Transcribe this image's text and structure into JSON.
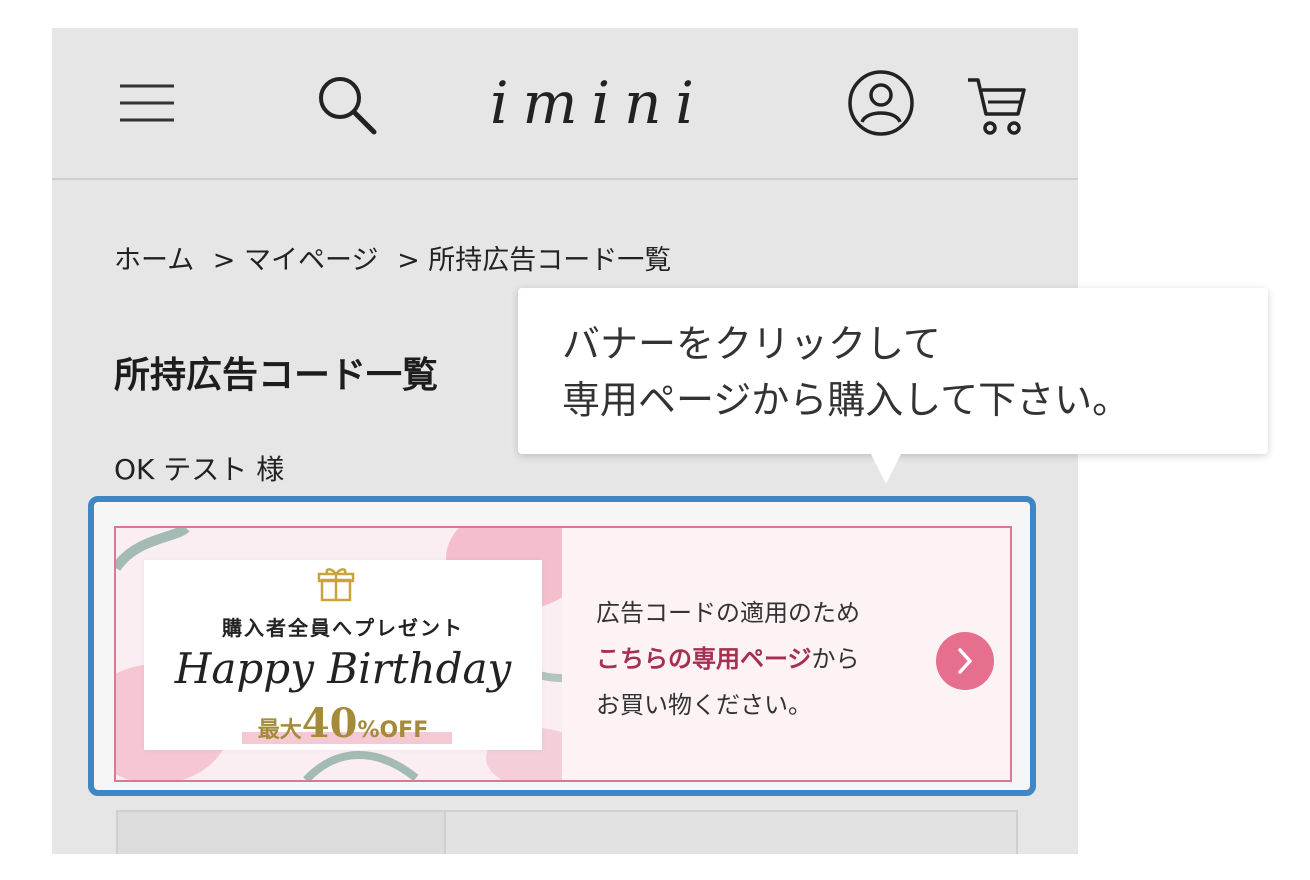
{
  "header": {
    "logo": "imini",
    "menu_icon": "hamburger-menu-icon",
    "search_icon": "search-icon",
    "account_icon": "user-account-icon",
    "cart_icon": "cart-icon"
  },
  "breadcrumb": {
    "items": [
      "ホーム",
      "> マイページ",
      "> 所持広告コード一覧"
    ]
  },
  "page": {
    "title": "所持広告コード一覧",
    "user_name": "OK テスト 様"
  },
  "banner": {
    "promo_subtitle": "購入者全員へプレゼント",
    "promo_title": "Happy Birthday",
    "off_prefix": "最大",
    "off_value": "40",
    "off_suffix": "%OFF",
    "line1": "広告コードの適用のため",
    "line2_link": "こちらの専用ページ",
    "line2_rest": "から",
    "line3": "お買い物ください。",
    "arrow_icon": "chevron-right-icon",
    "highlight_color": "#3f86c6",
    "accent_color": "#e66f8e"
  },
  "callout": {
    "line1": "バナーをクリックして",
    "line2": "専用ページから購入して下さい。"
  }
}
